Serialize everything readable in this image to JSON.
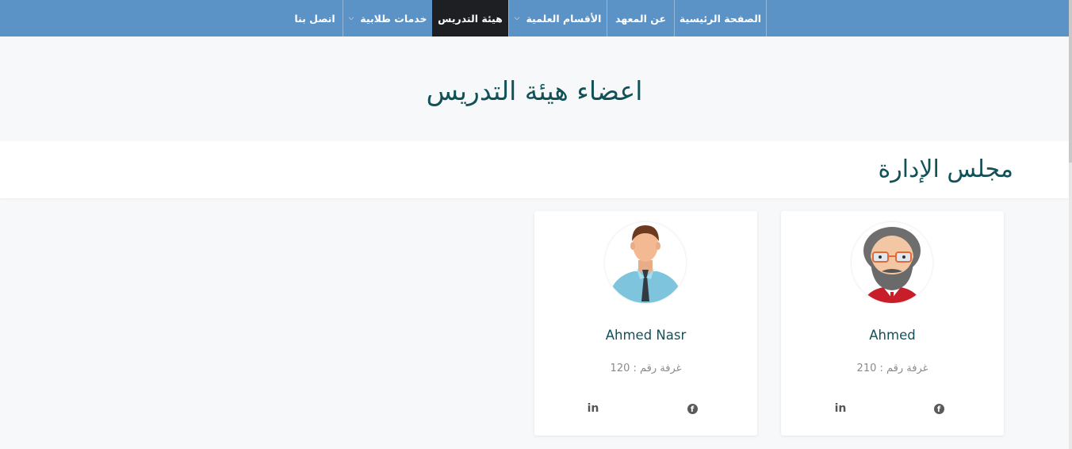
{
  "nav": {
    "items": [
      {
        "label": "الصفحة الرئيسية",
        "dropdown": false,
        "active": false
      },
      {
        "label": "عن المعهد",
        "dropdown": false,
        "active": false
      },
      {
        "label": "الأقسام العلمية",
        "dropdown": true,
        "active": false
      },
      {
        "label": "هيئة التدريس",
        "dropdown": false,
        "active": true
      },
      {
        "label": "خدمات طلابية",
        "dropdown": true,
        "active": false
      },
      {
        "label": "اتصل بنا",
        "dropdown": false,
        "active": false
      }
    ]
  },
  "page": {
    "title": "اعضاء هيئة التدريس",
    "section_title": "مجلس الإدارة"
  },
  "members": [
    {
      "name": "Ahmed",
      "room": "غرفة رقم : 210",
      "avatar": "bearded-man-with-glasses-icon"
    },
    {
      "name": "Ahmed Nasr",
      "room": "غرفة رقم : 120",
      "avatar": "man-with-tie-icon"
    }
  ],
  "social": {
    "linkedin_glyph": "in",
    "facebook_glyph": "f"
  },
  "colors": {
    "navbar": "#5b93c6",
    "nav_active": "#1d1f22",
    "heading": "#135158",
    "background": "#f6f8fa"
  }
}
